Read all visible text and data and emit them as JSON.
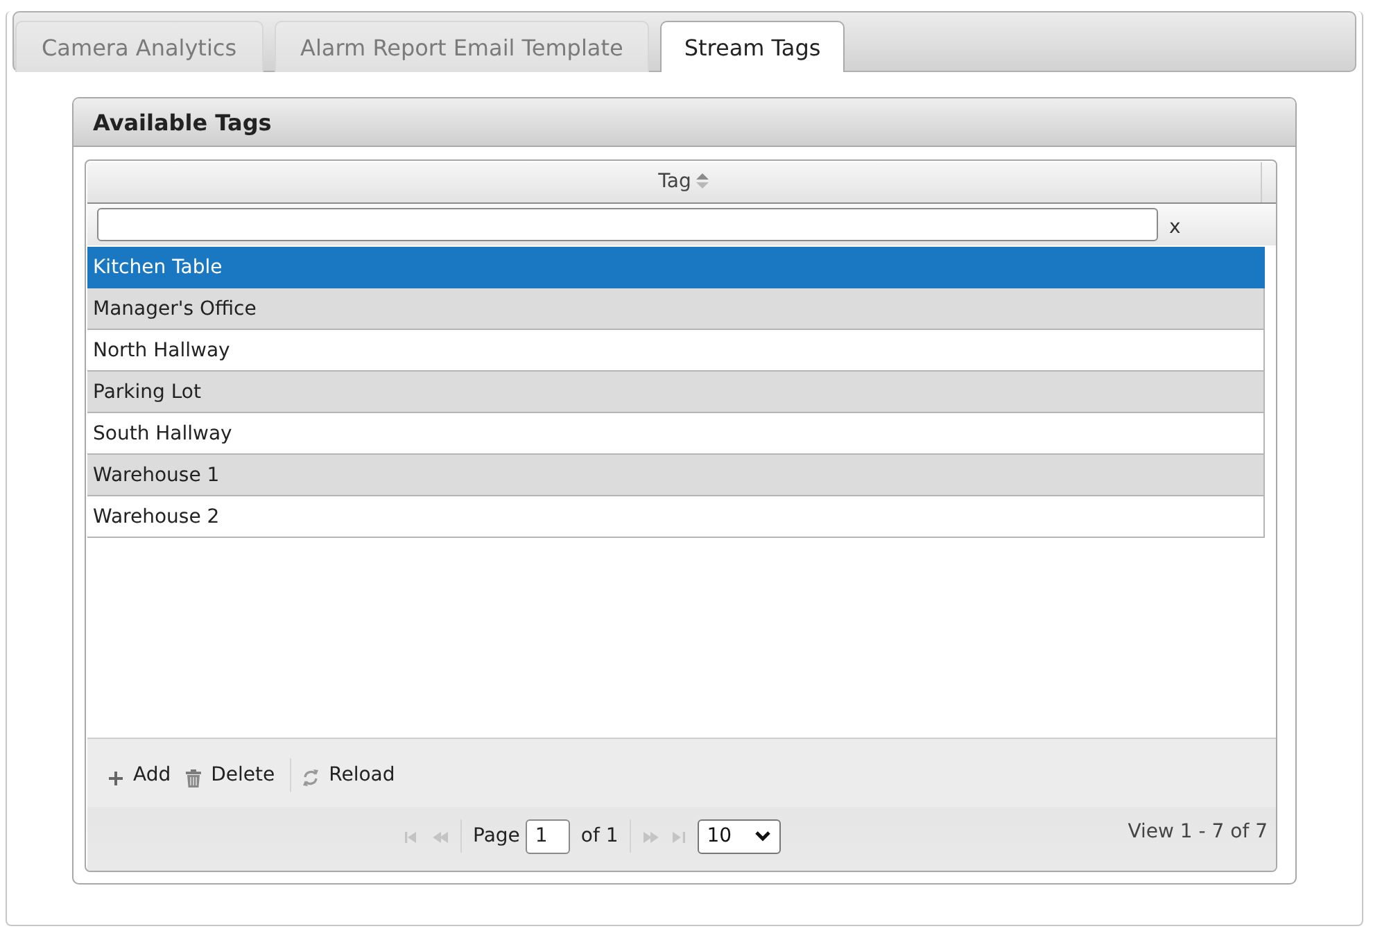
{
  "tabs": [
    {
      "label": "Camera Analytics",
      "selected": false
    },
    {
      "label": "Alarm Report Email Template",
      "selected": false
    },
    {
      "label": "Stream Tags",
      "selected": true
    }
  ],
  "panel": {
    "title": "Available Tags"
  },
  "grid": {
    "columns": [
      {
        "label": "Tag"
      }
    ],
    "filter": {
      "clear_label": "x"
    },
    "rows": [
      {
        "tag": "Kitchen Table",
        "selected": true
      },
      {
        "tag": "Manager's Office",
        "selected": false
      },
      {
        "tag": "North Hallway",
        "selected": false
      },
      {
        "tag": "Parking Lot",
        "selected": false
      },
      {
        "tag": "South Hallway",
        "selected": false
      },
      {
        "tag": "Warehouse 1",
        "selected": false
      },
      {
        "tag": "Warehouse 2",
        "selected": false
      }
    ]
  },
  "toolbar": {
    "buttons": [
      {
        "label": "Add",
        "kind": "add"
      },
      {
        "label": "Delete",
        "kind": "delete"
      },
      {
        "label": "Reload",
        "kind": "reload"
      }
    ]
  },
  "pager": {
    "back_buttons": [
      {
        "kind": "first",
        "disabled": true
      },
      {
        "kind": "prev",
        "disabled": true
      }
    ],
    "page_label": "Page",
    "page": "1",
    "of_label": "of 1",
    "next_buttons": [
      {
        "kind": "next",
        "disabled": true
      },
      {
        "kind": "last",
        "disabled": true
      }
    ],
    "page_size": "10",
    "summary": "View 1 - 7 of 7"
  }
}
